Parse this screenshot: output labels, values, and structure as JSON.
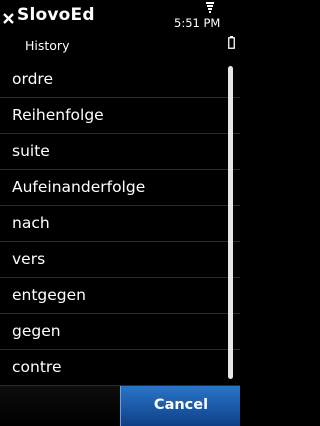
{
  "header": {
    "title": "SlovoEd",
    "subtitle": "History",
    "time": "5:51 PM"
  },
  "icons": {
    "close": "close-icon",
    "signal": "signal-icon",
    "battery": "battery-icon"
  },
  "history": {
    "items": [
      {
        "label": "ordre"
      },
      {
        "label": "Reihenfolge"
      },
      {
        "label": "suite"
      },
      {
        "label": "Aufeinanderfolge"
      },
      {
        "label": "nach"
      },
      {
        "label": "vers"
      },
      {
        "label": "entgegen"
      },
      {
        "label": "gegen"
      },
      {
        "label": "contre"
      }
    ]
  },
  "toolbar": {
    "cancel_label": "Cancel"
  },
  "colors": {
    "background": "#000000",
    "text": "#ffffff",
    "accent_button": "#1c5ba9",
    "scrollbar": "#e6e6e6"
  }
}
